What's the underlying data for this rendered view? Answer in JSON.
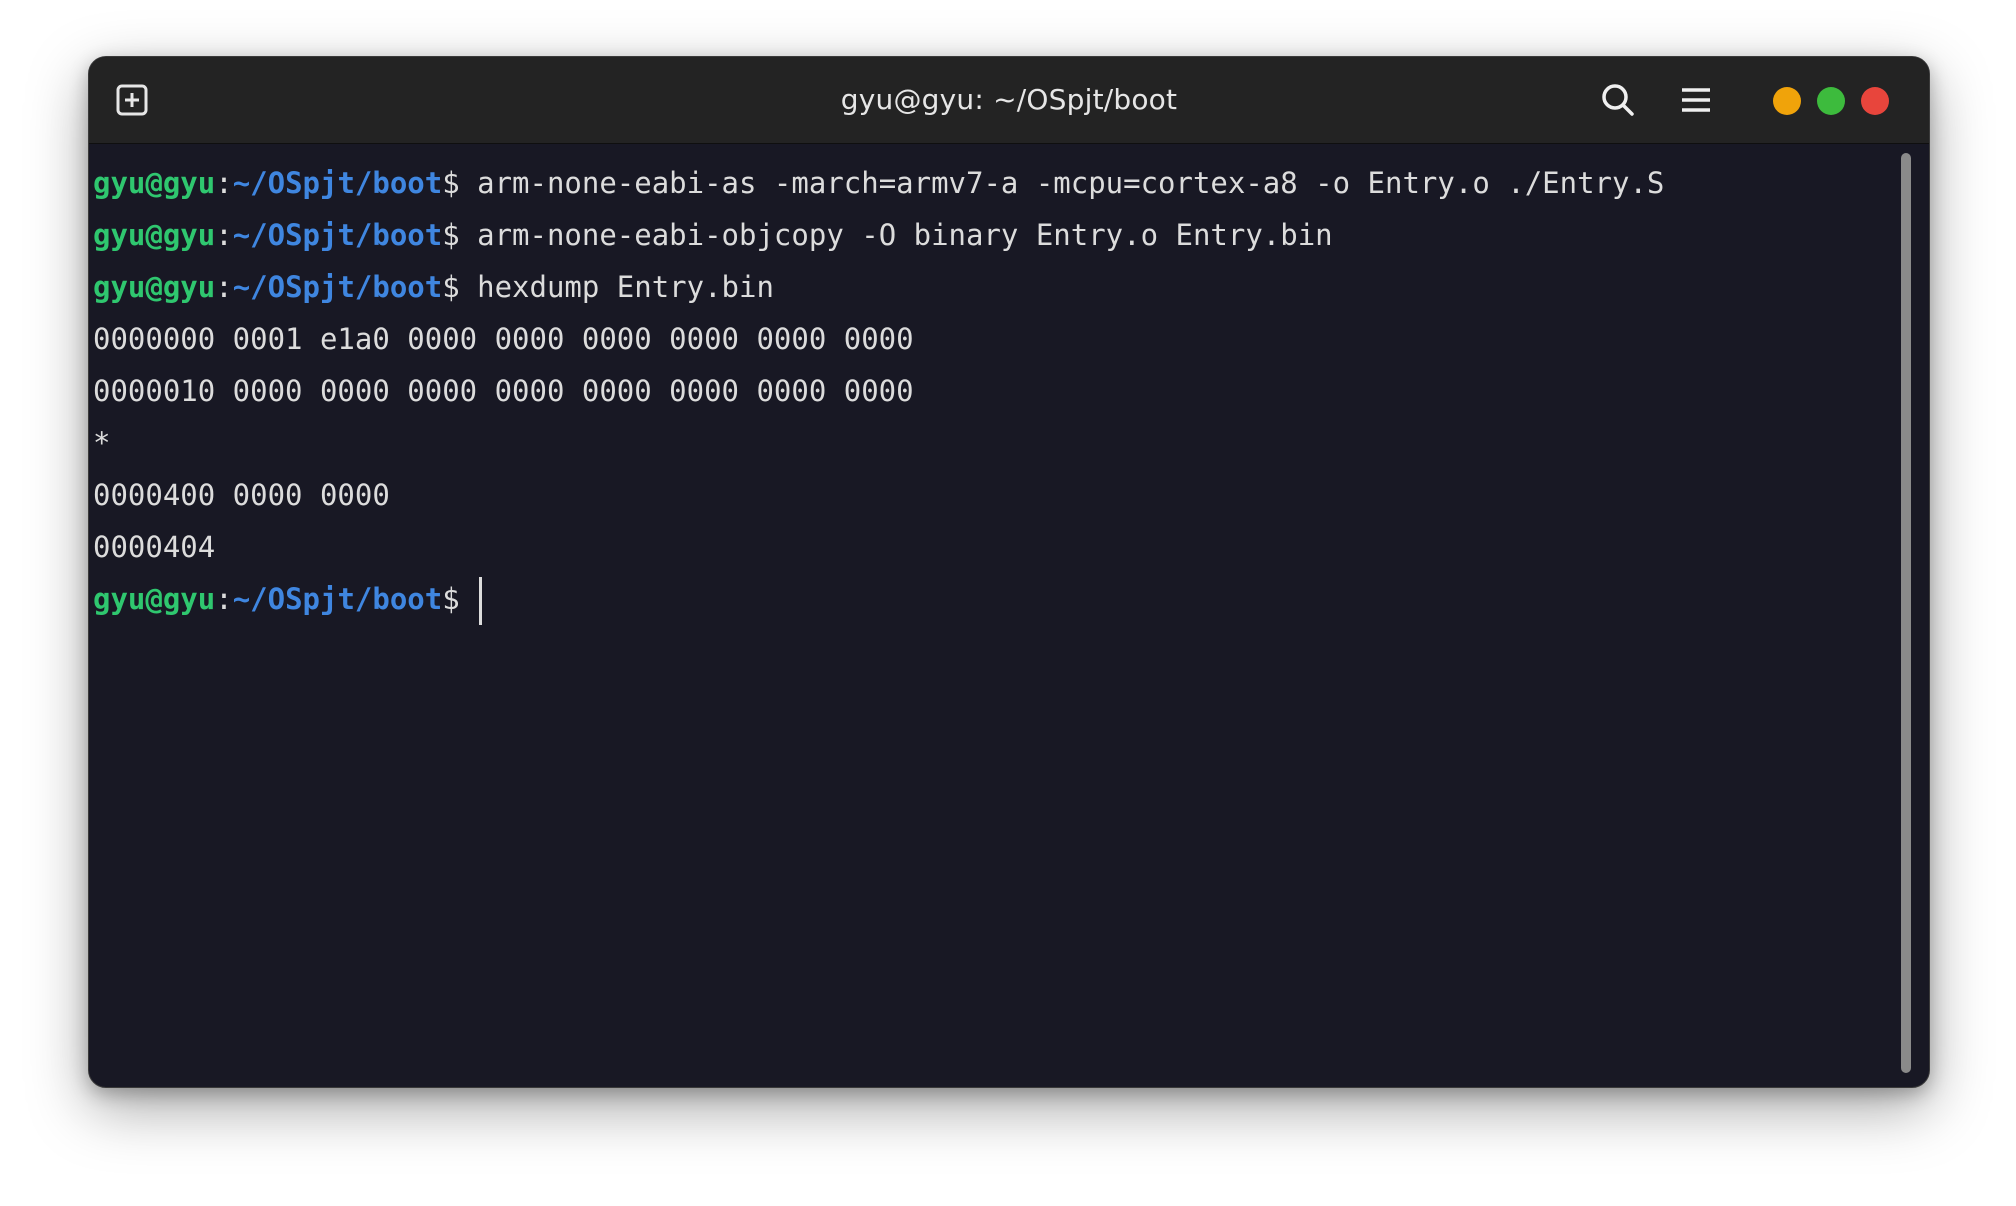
{
  "window": {
    "title": "gyu@gyu: ~/OSpjt/boot"
  },
  "toolbar": {
    "new_tab_icon": "new-tab-icon",
    "search_icon": "search-icon",
    "menu_icon": "hamburger-menu-icon"
  },
  "window_controls": {
    "minimize_color": "#f0a30a",
    "maximize_color": "#3dbb3d",
    "close_color": "#e8453c"
  },
  "prompt": {
    "user": "gyu@gyu",
    "colon": ":",
    "path": "~/OSpjt/boot",
    "dollar": "$ "
  },
  "terminal": {
    "commands": [
      "arm-none-eabi-as -march=armv7-a -mcpu=cortex-a8 -o Entry.o ./Entry.S",
      "arm-none-eabi-objcopy -O binary Entry.o Entry.bin",
      "hexdump Entry.bin"
    ],
    "output": [
      "0000000 0001 e1a0 0000 0000 0000 0000 0000 0000",
      "0000010 0000 0000 0000 0000 0000 0000 0000 0000",
      "*",
      "0000400 0000 0000",
      "0000404"
    ]
  },
  "colors": {
    "background": "#181824",
    "titlebar": "#232323",
    "user": "#2fc76f",
    "path": "#3f86e0",
    "text": "#dcdcdc"
  }
}
